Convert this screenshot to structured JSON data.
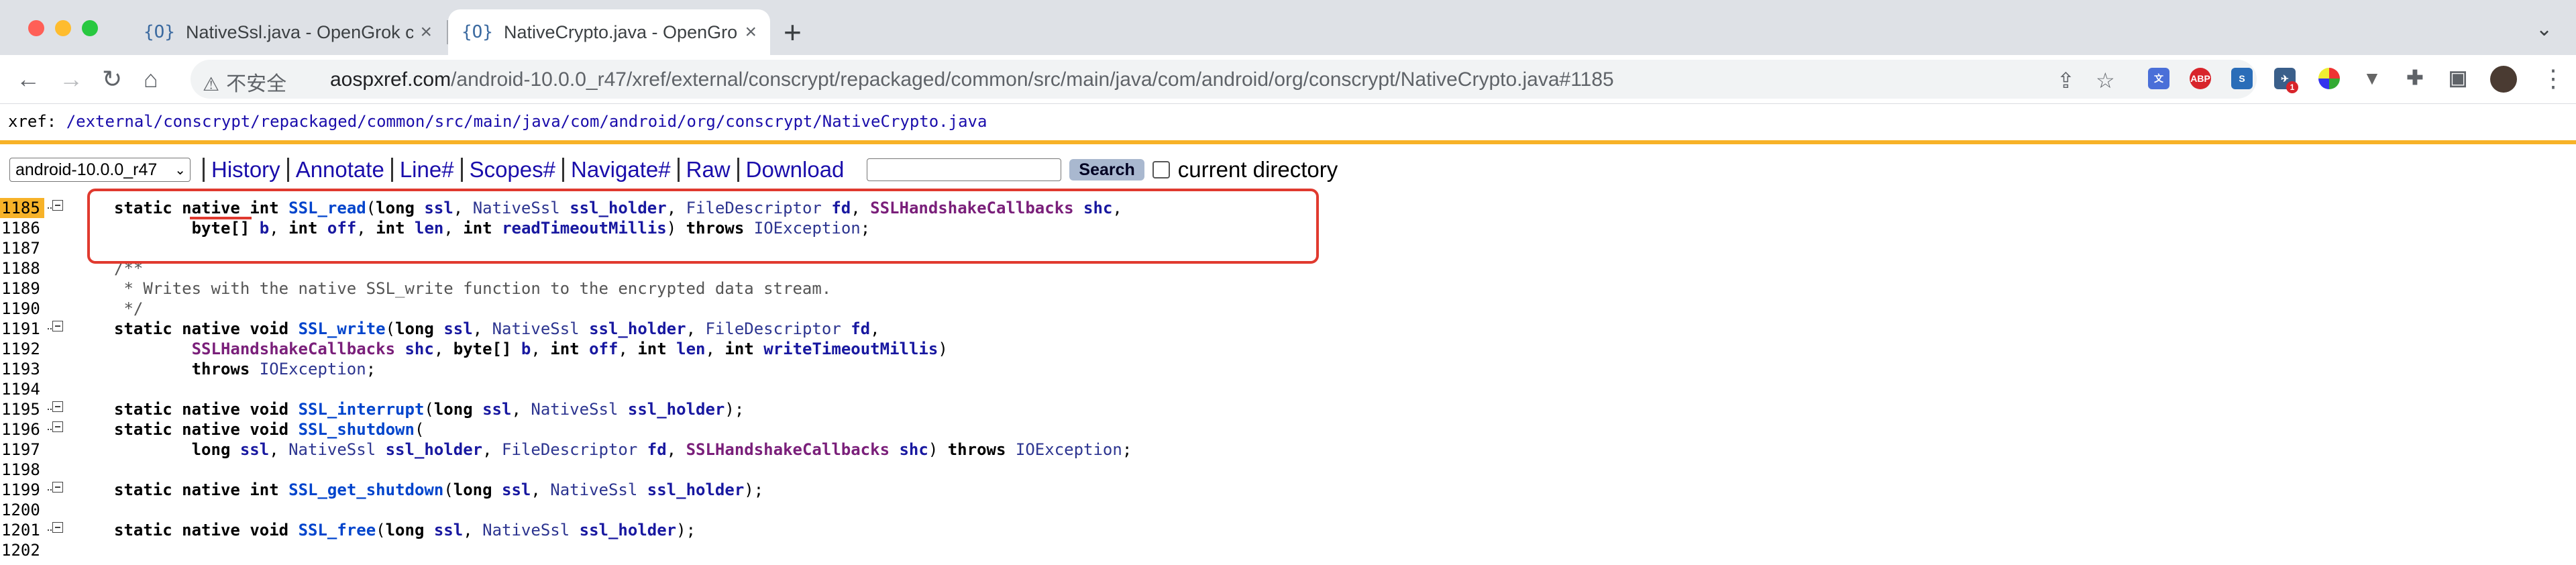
{
  "browser": {
    "tabs": [
      {
        "icon": "{O}",
        "title": "NativeSsl.java - OpenGrok cross reference",
        "active": false
      },
      {
        "icon": "{O}",
        "title": "NativeCrypto.java - OpenGrok cross reference",
        "active": true
      }
    ],
    "security_label": "不安全",
    "url_host": "aospxref.com",
    "url_path": "/android-10.0.0_r47/xref/external/conscrypt/repackaged/common/src/main/java/com/android/org/conscrypt/NativeCrypto.java#1185",
    "extensions": [
      "translate-icon",
      "adblock-icon",
      "s-icon",
      "bird-icon",
      "color-icon",
      "vee-icon",
      "puzzle-icon",
      "sidepanel-icon"
    ],
    "ext_badge": "1",
    "adblock_label": "ABP"
  },
  "xref": {
    "prefix": "xref: ",
    "crumbs": [
      "/external",
      "/conscrypt",
      "/repackaged",
      "/common",
      "/src",
      "/main",
      "/java",
      "/com",
      "/android",
      "/org",
      "/conscrypt",
      "/NativeCrypto.java"
    ]
  },
  "menu": {
    "version": "android-10.0.0_r47",
    "links": [
      "History",
      "Annotate",
      "Line#",
      "Scopes#",
      "Navigate#",
      "Raw",
      "Download"
    ],
    "search_button": "Search",
    "checkbox_label": "current directory"
  },
  "code": {
    "highlight_line": "1185",
    "lines": [
      {
        "n": "1185",
        "fold": true
      },
      {
        "n": "1186",
        "fold": false
      },
      {
        "n": "1187",
        "fold": false
      },
      {
        "n": "1188",
        "fold": false
      },
      {
        "n": "1189",
        "fold": false
      },
      {
        "n": "1190",
        "fold": false
      },
      {
        "n": "1191",
        "fold": true
      },
      {
        "n": "1192",
        "fold": false
      },
      {
        "n": "1193",
        "fold": false
      },
      {
        "n": "1194",
        "fold": false
      },
      {
        "n": "1195",
        "fold": true
      },
      {
        "n": "1196",
        "fold": true
      },
      {
        "n": "1197",
        "fold": false
      },
      {
        "n": "1198",
        "fold": false
      },
      {
        "n": "1199",
        "fold": true
      },
      {
        "n": "1200",
        "fold": false
      },
      {
        "n": "1201",
        "fold": true
      },
      {
        "n": "1202",
        "fold": false
      }
    ],
    "tokens": {
      "static": "static",
      "native": "native",
      "int": "int",
      "void": "void",
      "long": "long",
      "byte_arr": "byte[]",
      "throws": "throws",
      "SSL_read": "SSL_read",
      "SSL_write": "SSL_write",
      "SSL_interrupt": "SSL_interrupt",
      "SSL_shutdown": "SSL_shutdown",
      "SSL_get_shutdown": "SSL_get_shutdown",
      "SSL_free": "SSL_free",
      "NativeSsl": "NativeSsl",
      "FileDescriptor": "FileDescriptor",
      "SSLHandshakeCallbacks": "SSLHandshakeCallbacks",
      "IOException": "IOException",
      "ssl": "ssl",
      "ssl_holder": "ssl_holder",
      "fd": "fd",
      "shc": "shc",
      "b": "b",
      "off": "off",
      "len": "len",
      "readTimeoutMillis": "readTimeoutMillis",
      "writeTimeoutMillis": "writeTimeoutMillis",
      "comment1": "/**",
      "comment2": " * Writes with the native SSL_write function to the encrypted data stream.",
      "comment3": " */"
    }
  }
}
